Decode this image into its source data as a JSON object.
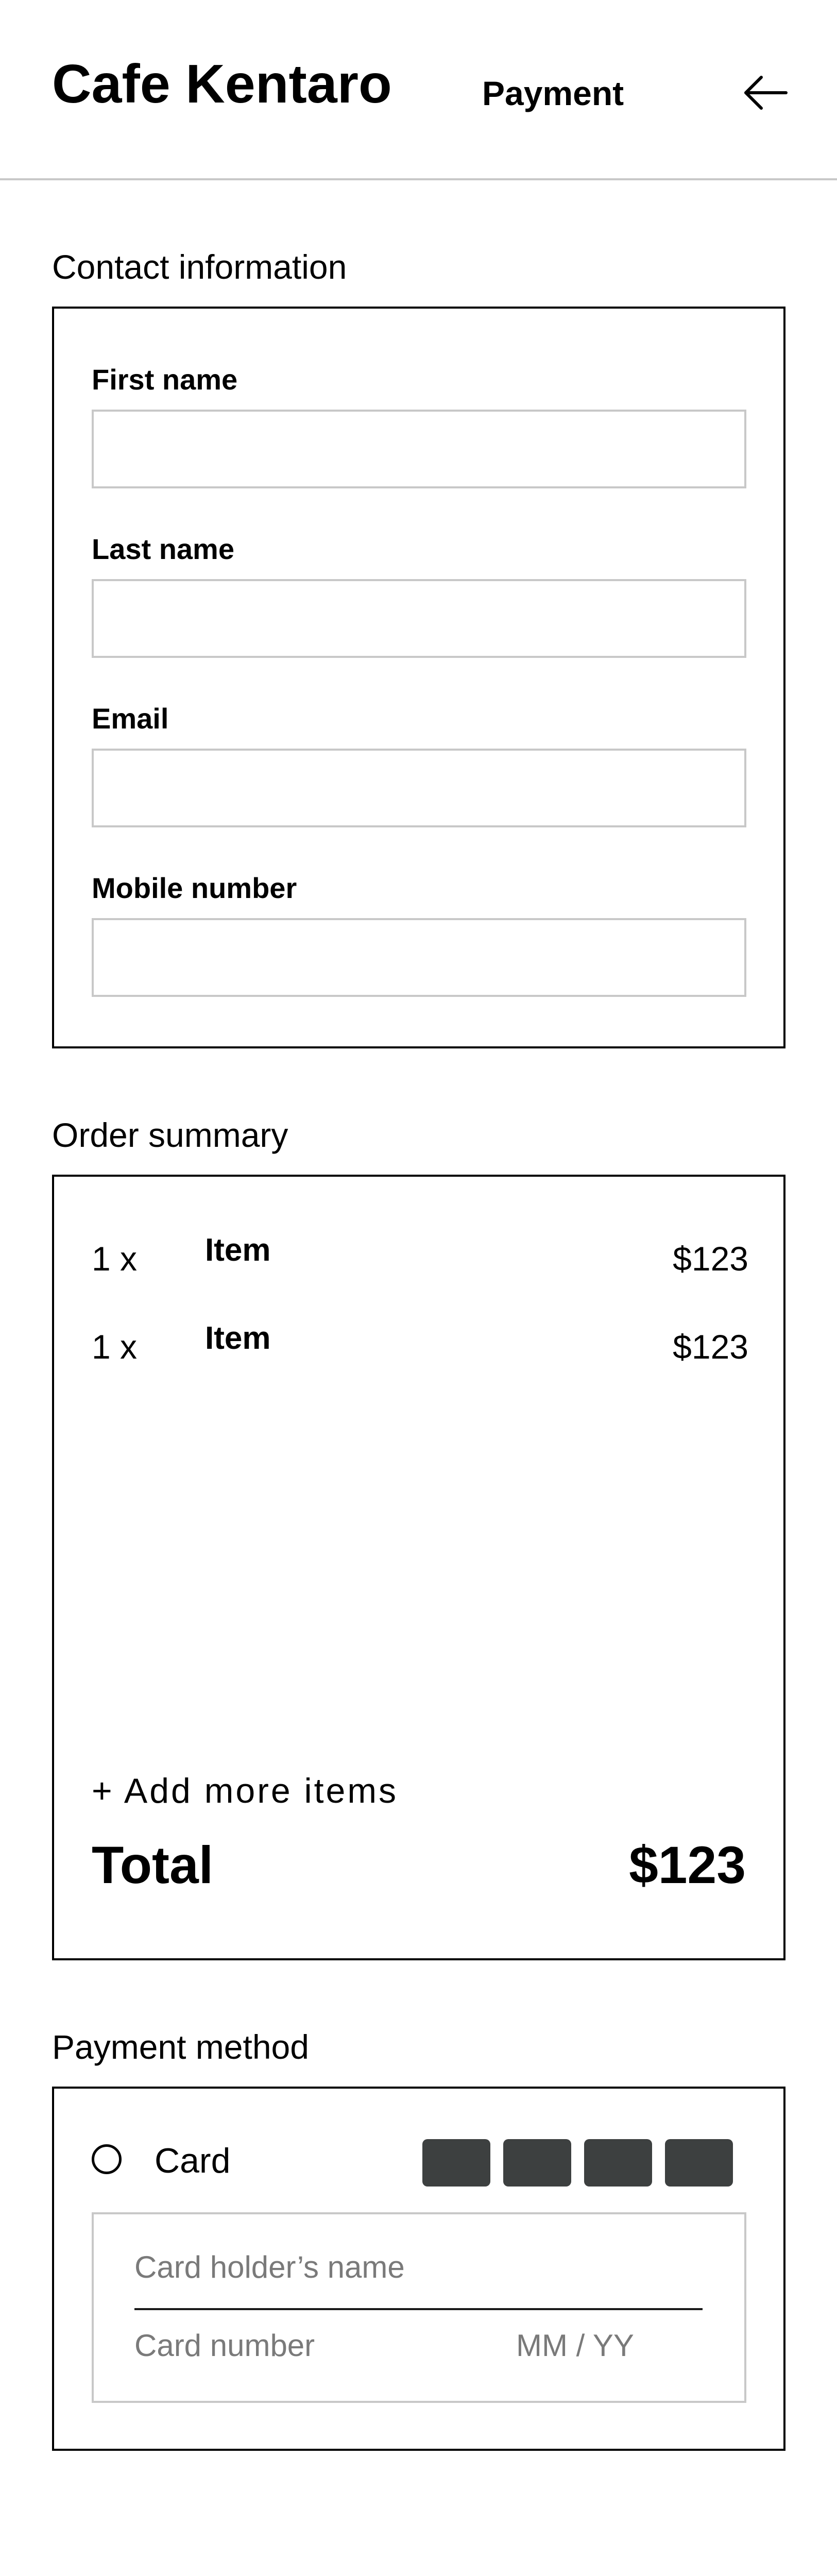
{
  "header": {
    "brand": "Cafe Kentaro",
    "title": "Payment",
    "back_icon": "arrow-left-icon"
  },
  "contact": {
    "heading": "Contact information",
    "fields": [
      {
        "label": "First name",
        "value": "",
        "placeholder": ""
      },
      {
        "label": "Last name",
        "value": "",
        "placeholder": ""
      },
      {
        "label": "Email",
        "value": "",
        "placeholder": ""
      },
      {
        "label": "Mobile number",
        "value": "",
        "placeholder": ""
      }
    ]
  },
  "order": {
    "heading": "Order summary",
    "items": [
      {
        "qty": "1 x",
        "name": "Item",
        "price": "$123"
      },
      {
        "qty": "1 x",
        "name": "Item",
        "price": "$123"
      }
    ],
    "add_more_label": "+ Add more items",
    "total_label": "Total",
    "total_value": "$123"
  },
  "payment": {
    "heading": "Payment method",
    "option_label": "Card",
    "card_logo_color": "#3d4040",
    "card_holder_placeholder": "Card holder’s name",
    "card_number_placeholder": "Card number",
    "expiry_placeholder": "MM / YY"
  },
  "colors": {
    "border": "#000000",
    "input_border": "#c8c8c8",
    "placeholder": "#7a7a7a"
  }
}
